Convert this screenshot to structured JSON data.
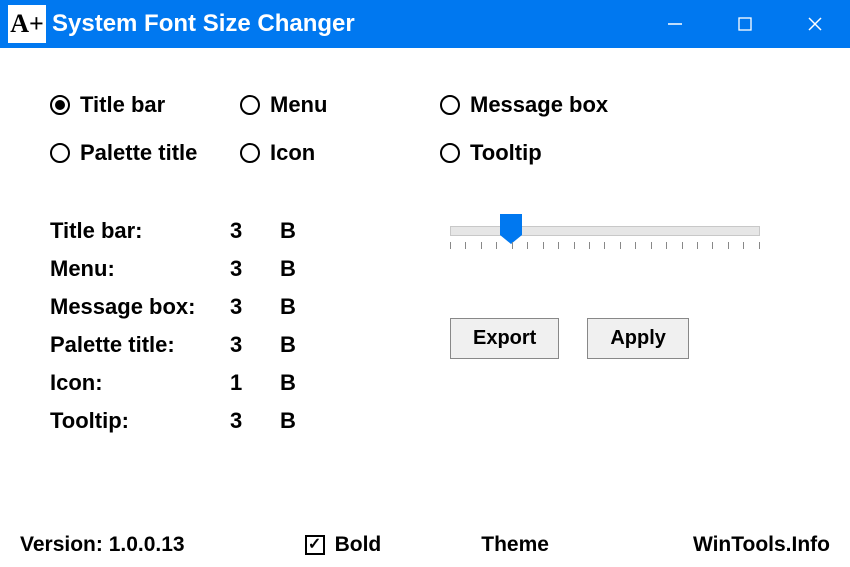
{
  "titlebar": {
    "icon_text": "A+",
    "title": "System Font Size Changer"
  },
  "radios": {
    "title_bar": "Title bar",
    "menu": "Menu",
    "message_box": "Message box",
    "palette_title": "Palette title",
    "icon": "Icon",
    "tooltip": "Tooltip",
    "selected": "title_bar"
  },
  "settings": [
    {
      "label": "Title bar:",
      "value": "3",
      "bold": "B"
    },
    {
      "label": "Menu:",
      "value": "3",
      "bold": "B"
    },
    {
      "label": "Message box:",
      "value": "3",
      "bold": "B"
    },
    {
      "label": "Palette title:",
      "value": "3",
      "bold": "B"
    },
    {
      "label": "Icon:",
      "value": "1",
      "bold": "B"
    },
    {
      "label": "Tooltip:",
      "value": "3",
      "bold": "B"
    }
  ],
  "buttons": {
    "export": "Export",
    "apply": "Apply"
  },
  "footer": {
    "version_label": "Version: 1.0.0.13",
    "bold_label": "Bold",
    "bold_checked": true,
    "theme": "Theme",
    "site": "WinTools.Info"
  }
}
